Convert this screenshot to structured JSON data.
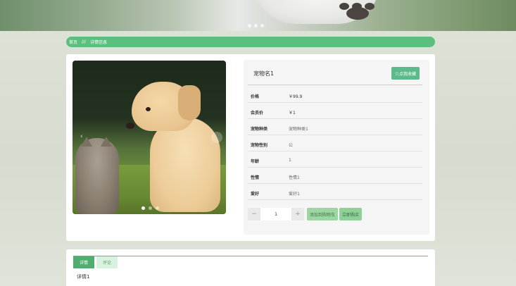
{
  "breadcrumb": {
    "home": "首页",
    "separator": "///",
    "current": "详情信息"
  },
  "product": {
    "name": "宠物名1",
    "collect_label": "☆点我收藏",
    "attributes": [
      {
        "label": "价格",
        "value": "￥99.9"
      },
      {
        "label": "会员价",
        "value": "￥1"
      },
      {
        "label": "宠物种类",
        "value": "宠物种类1"
      },
      {
        "label": "宠物性别",
        "value": "公"
      },
      {
        "label": "年龄",
        "value": "1"
      },
      {
        "label": "性情",
        "value": "性情1"
      },
      {
        "label": "爱好",
        "value": "爱好1"
      }
    ],
    "quantity": "1",
    "minus": "−",
    "plus": "+",
    "add_cart_label": "添加到购物车",
    "buy_label": "立即购买"
  },
  "carousel": {
    "prev": "‹",
    "active_index": 1,
    "count": 3
  },
  "tabs": [
    {
      "label": "详情"
    },
    {
      "label": "评论"
    }
  ],
  "detail_text": "详情1",
  "colors": {
    "accent": "#5cbf7f",
    "accent_dark": "#4fae6f"
  }
}
